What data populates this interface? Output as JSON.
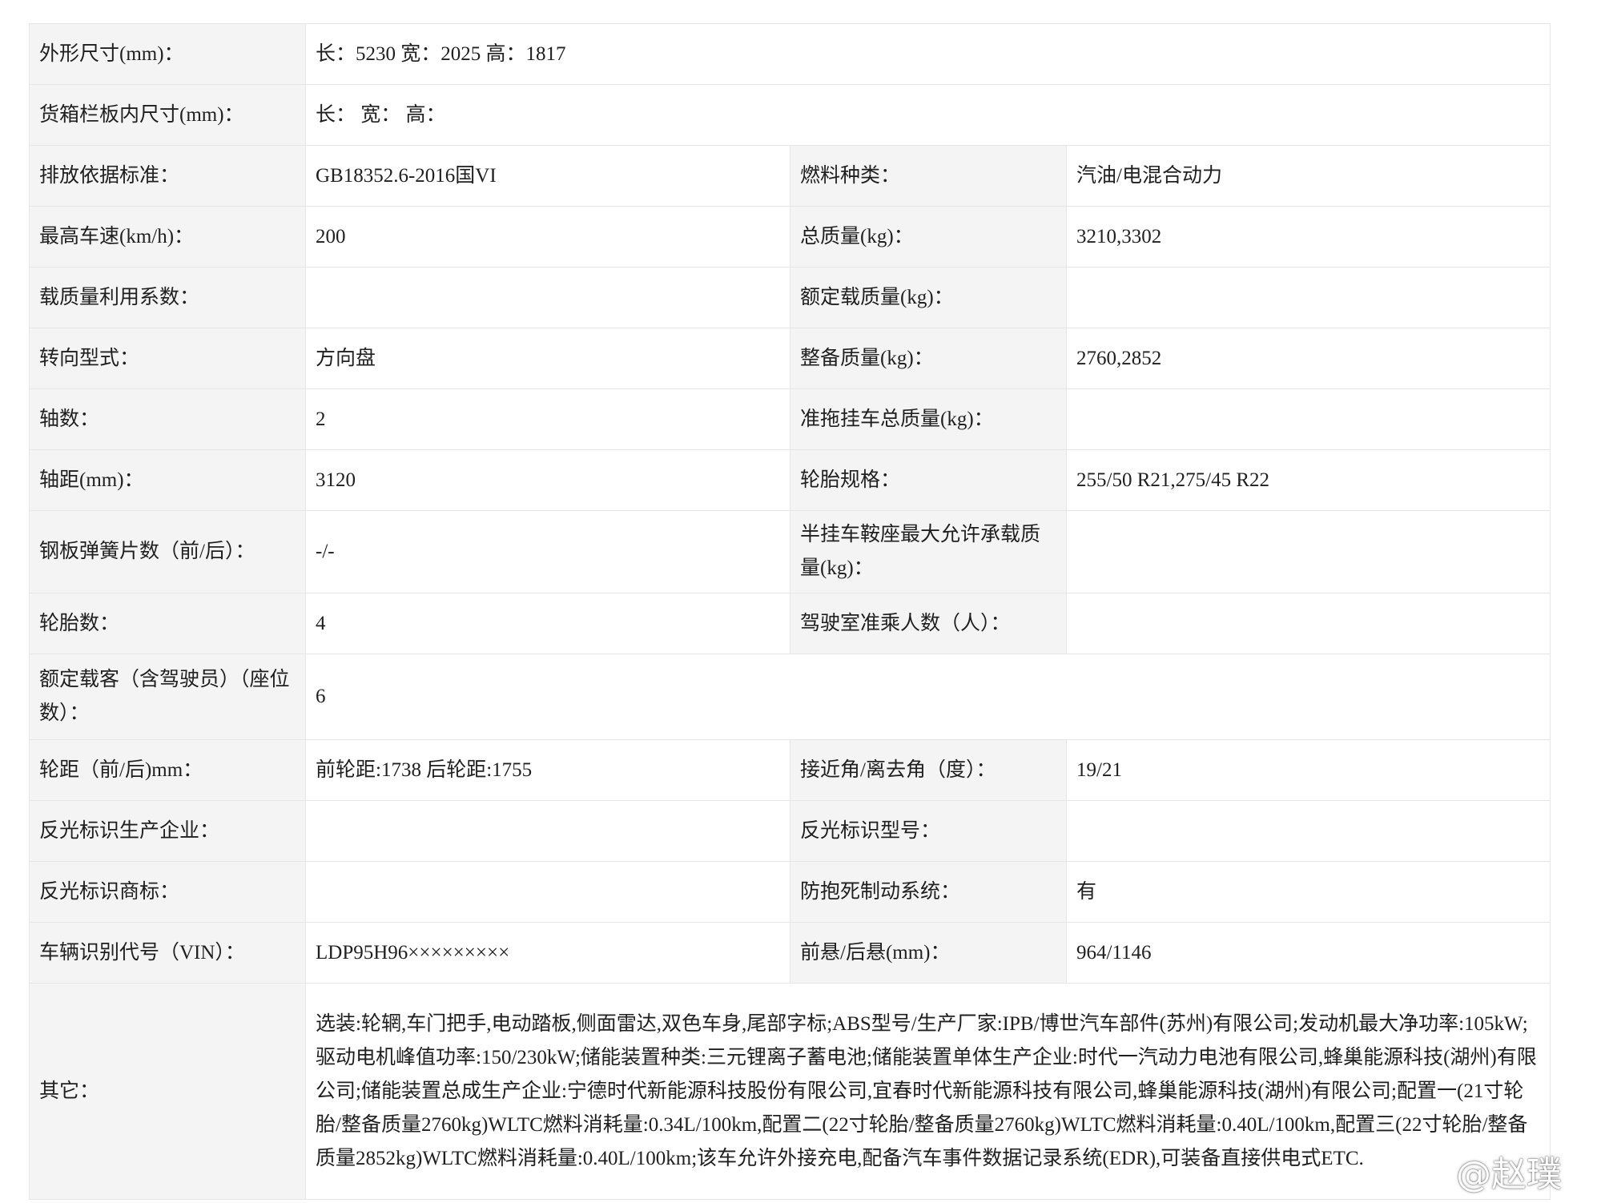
{
  "rows": [
    {
      "label": "外形尺寸(mm)：",
      "value": "长：5230 宽：2025 高：1817"
    },
    {
      "label": "货箱栏板内尺寸(mm)：",
      "value": "长： 宽： 高："
    },
    {
      "label": "排放依据标准：",
      "value": "GB18352.6-2016国VI",
      "label2": "燃料种类：",
      "value2": "汽油/电混合动力"
    },
    {
      "label": "最高车速(km/h)：",
      "value": "200",
      "label2": "总质量(kg)：",
      "value2": "3210,3302"
    },
    {
      "label": "载质量利用系数：",
      "value": "",
      "label2": "额定载质量(kg)：",
      "value2": ""
    },
    {
      "label": "转向型式：",
      "value": "方向盘",
      "label2": "整备质量(kg)：",
      "value2": "2760,2852"
    },
    {
      "label": "轴数：",
      "value": "2",
      "label2": "准拖挂车总质量(kg)：",
      "value2": ""
    },
    {
      "label": "轴距(mm)：",
      "value": "3120",
      "label2": "轮胎规格：",
      "value2": "255/50 R21,275/45 R22"
    },
    {
      "label": "钢板弹簧片数（前/后）：",
      "value": "-/-",
      "label2": "半挂车鞍座最大允许承载质量(kg)：",
      "value2": ""
    },
    {
      "label": "轮胎数：",
      "value": "4",
      "label2": "驾驶室准乘人数（人）：",
      "value2": ""
    },
    {
      "label": "额定载客（含驾驶员）（座位数）：",
      "value": "6"
    },
    {
      "label": "轮距（前/后)mm：",
      "value": "前轮距:1738 后轮距:1755",
      "label2": "接近角/离去角（度）：",
      "value2": "19/21"
    },
    {
      "label": "反光标识生产企业：",
      "value": "",
      "label2": "反光标识型号：",
      "value2": ""
    },
    {
      "label": "反光标识商标：",
      "value": "",
      "label2": "防抱死制动系统：",
      "value2": "有"
    },
    {
      "label": "车辆识别代号（VIN）：",
      "value": "LDP95H96×××××××××",
      "label2": "前悬/后悬(mm)：",
      "value2": "964/1146"
    },
    {
      "label": "其它：",
      "value": "选装:轮辋,车门把手,电动踏板,侧面雷达,双色车身,尾部字标;ABS型号/生产厂家:IPB/博世汽车部件(苏州)有限公司;发动机最大净功率:105kW;驱动电机峰值功率:150/230kW;储能装置种类:三元锂离子蓄电池;储能装置单体生产企业:时代一汽动力电池有限公司,蜂巢能源科技(湖州)有限公司;储能装置总成生产企业:宁德时代新能源科技股份有限公司,宜春时代新能源科技有限公司,蜂巢能源科技(湖州)有限公司;配置一(21寸轮胎/整备质量2760kg)WLTC燃料消耗量:0.34L/100km,配置二(22寸轮胎/整备质量2760kg)WLTC燃料消耗量:0.40L/100km,配置三(22寸轮胎/整备质量2852kg)WLTC燃料消耗量:0.40L/100km;该车允许外接充电,配备汽车事件数据记录系统(EDR),可装备直接供电式ETC."
    }
  ],
  "watermark": {
    "text": "@赵璞",
    "icon": "weibo-logo-icon"
  }
}
